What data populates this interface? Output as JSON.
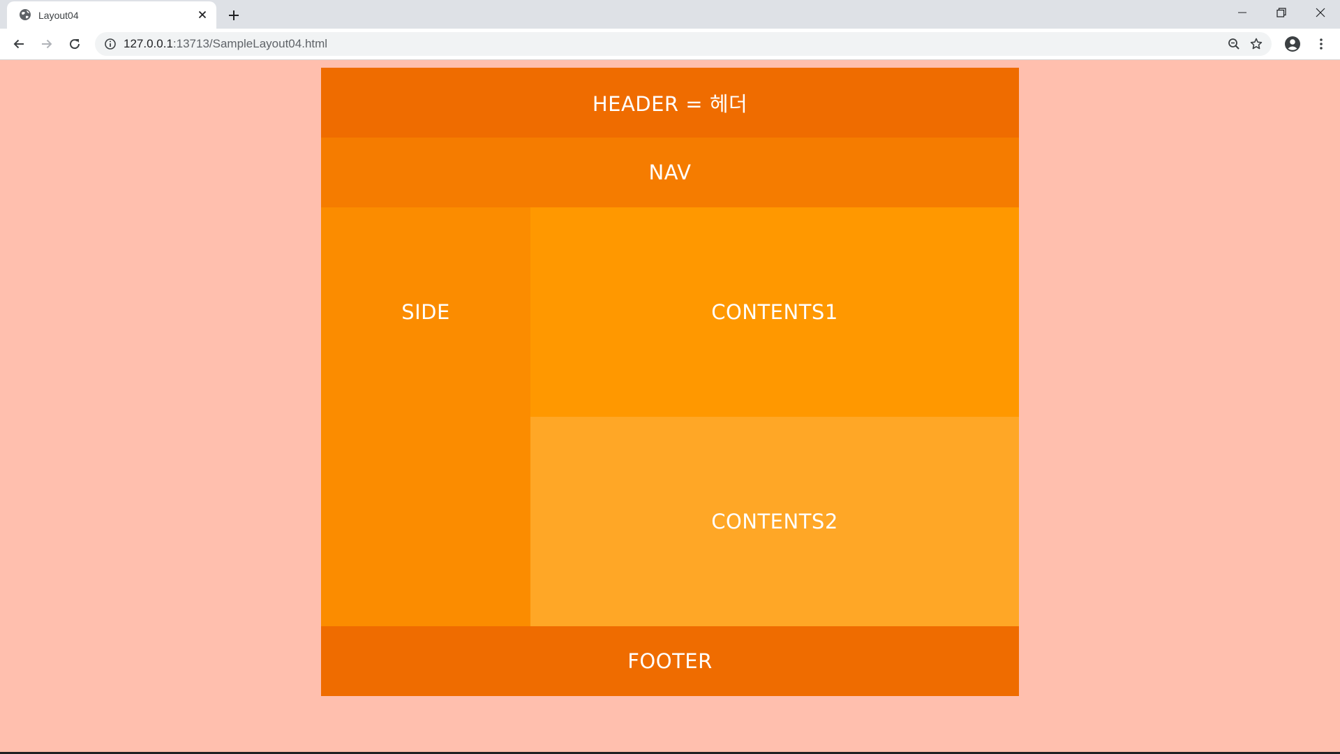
{
  "browser": {
    "tab": {
      "title": "Layout04"
    },
    "address_bar": {
      "url_host": "127.0.0.1",
      "url_path": ":13713/SampleLayout04.html"
    }
  },
  "page": {
    "header": "HEADER = 헤더",
    "nav": "NAV",
    "side": "SIDE",
    "contents1": "CONTENTS1",
    "contents2": "CONTENTS2",
    "footer": "FOOTER"
  },
  "colors": {
    "page_background": "#ffbfae",
    "header": "#ef6c00",
    "nav": "#f57c00",
    "side": "#fb8c00",
    "contents1": "#ff9800",
    "contents2": "#ffa726",
    "footer": "#ef6c00"
  },
  "icons": {
    "favicon": "globe-icon",
    "tab_close": "close-icon",
    "new_tab": "plus-icon",
    "back": "back-arrow-icon",
    "forward": "forward-arrow-icon",
    "reload": "reload-icon",
    "site_info": "info-icon",
    "zoom": "zoom-out-icon",
    "bookmark": "star-icon",
    "profile": "account-icon",
    "menu": "kebab-menu-icon",
    "minimize": "minimize-icon",
    "restore": "restore-icon",
    "close_window": "close-window-icon"
  }
}
